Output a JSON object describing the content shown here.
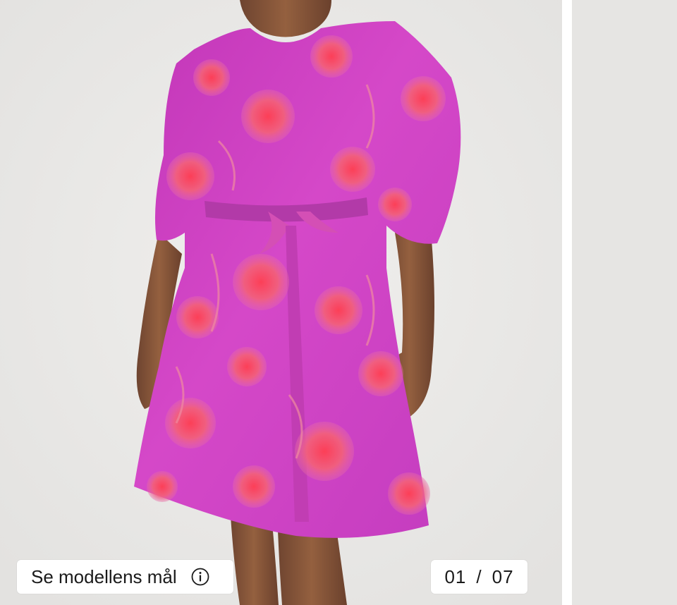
{
  "gallery": {
    "model_button_label": "Se modellens mål",
    "info_icon": "info-icon",
    "counter": {
      "current": "01",
      "separator": "/",
      "total": "07"
    }
  },
  "colors": {
    "background": "#e9e8e6",
    "dress_magenta": "#d23fc4",
    "dress_flower": "#f0506a",
    "skin": "#8a5a3e"
  }
}
